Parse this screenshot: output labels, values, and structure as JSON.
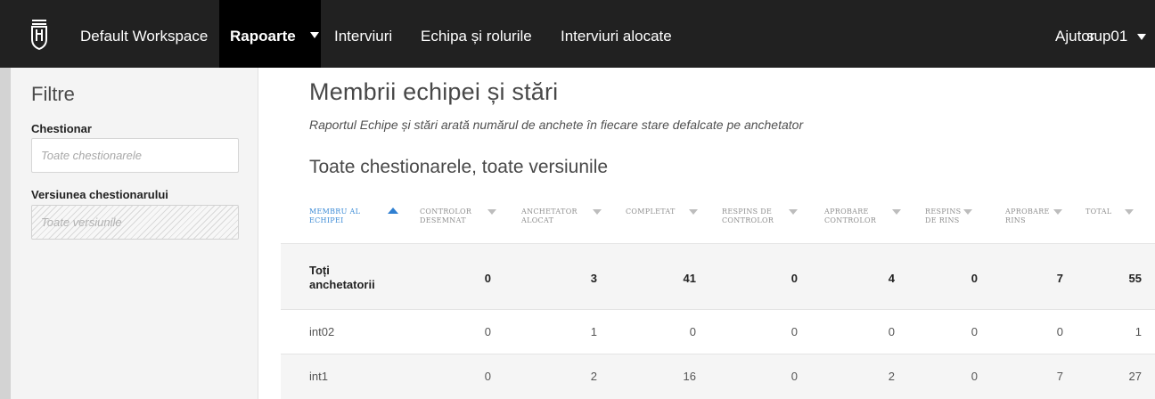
{
  "navbar": {
    "brand": "Default Workspace",
    "menu_active": "Rapoarte",
    "menu_items": [
      "Interviuri",
      "Echipa și rolurile",
      "Interviuri alocate"
    ],
    "help": "Ajutor",
    "user": "sup01"
  },
  "sidebar": {
    "title": "Filtre",
    "questionnaire_label": "Chestionar",
    "questionnaire_placeholder": "Toate chestionarele",
    "version_label": "Versiunea chestionarului",
    "version_placeholder": "Toate versiunile"
  },
  "main": {
    "title": "Membrii echipei și stări",
    "subtitle": "Raportul Echipe și stări arată numărul de anchete în fiecare stare defalcate pe anchetator",
    "section_title": "Toate chestionarele, toate versiunile"
  },
  "table": {
    "columns": [
      [
        "MEMBRU AL",
        "ECHIPEI"
      ],
      [
        "CONTROLOR",
        "DESEMNAT"
      ],
      [
        "ANCHETATOR",
        "ALOCAT"
      ],
      [
        "COMPLETAT",
        ""
      ],
      [
        "RESPINS DE",
        "CONTROLOR"
      ],
      [
        "APROBARE",
        "CONTROLOR"
      ],
      [
        "RESPINS",
        "DE RINS"
      ],
      [
        "APROBARE",
        "RINS"
      ],
      [
        "TOTAL",
        ""
      ]
    ],
    "sorted_column": 0,
    "sort_direction": "asc",
    "total_row": {
      "label": [
        "Toți",
        "anchetatorii"
      ],
      "values": [
        "0",
        "3",
        "41",
        "0",
        "4",
        "0",
        "7",
        "55"
      ]
    },
    "rows": [
      {
        "name": "int02",
        "values": [
          "0",
          "1",
          "0",
          "0",
          "0",
          "0",
          "0",
          "1"
        ]
      },
      {
        "name": "int1",
        "values": [
          "0",
          "2",
          "16",
          "0",
          "2",
          "0",
          "7",
          "27"
        ]
      }
    ]
  },
  "colors": {
    "navbar": "#212121",
    "nav_active": "#000000",
    "sort_accent": "#2f7fd1"
  }
}
